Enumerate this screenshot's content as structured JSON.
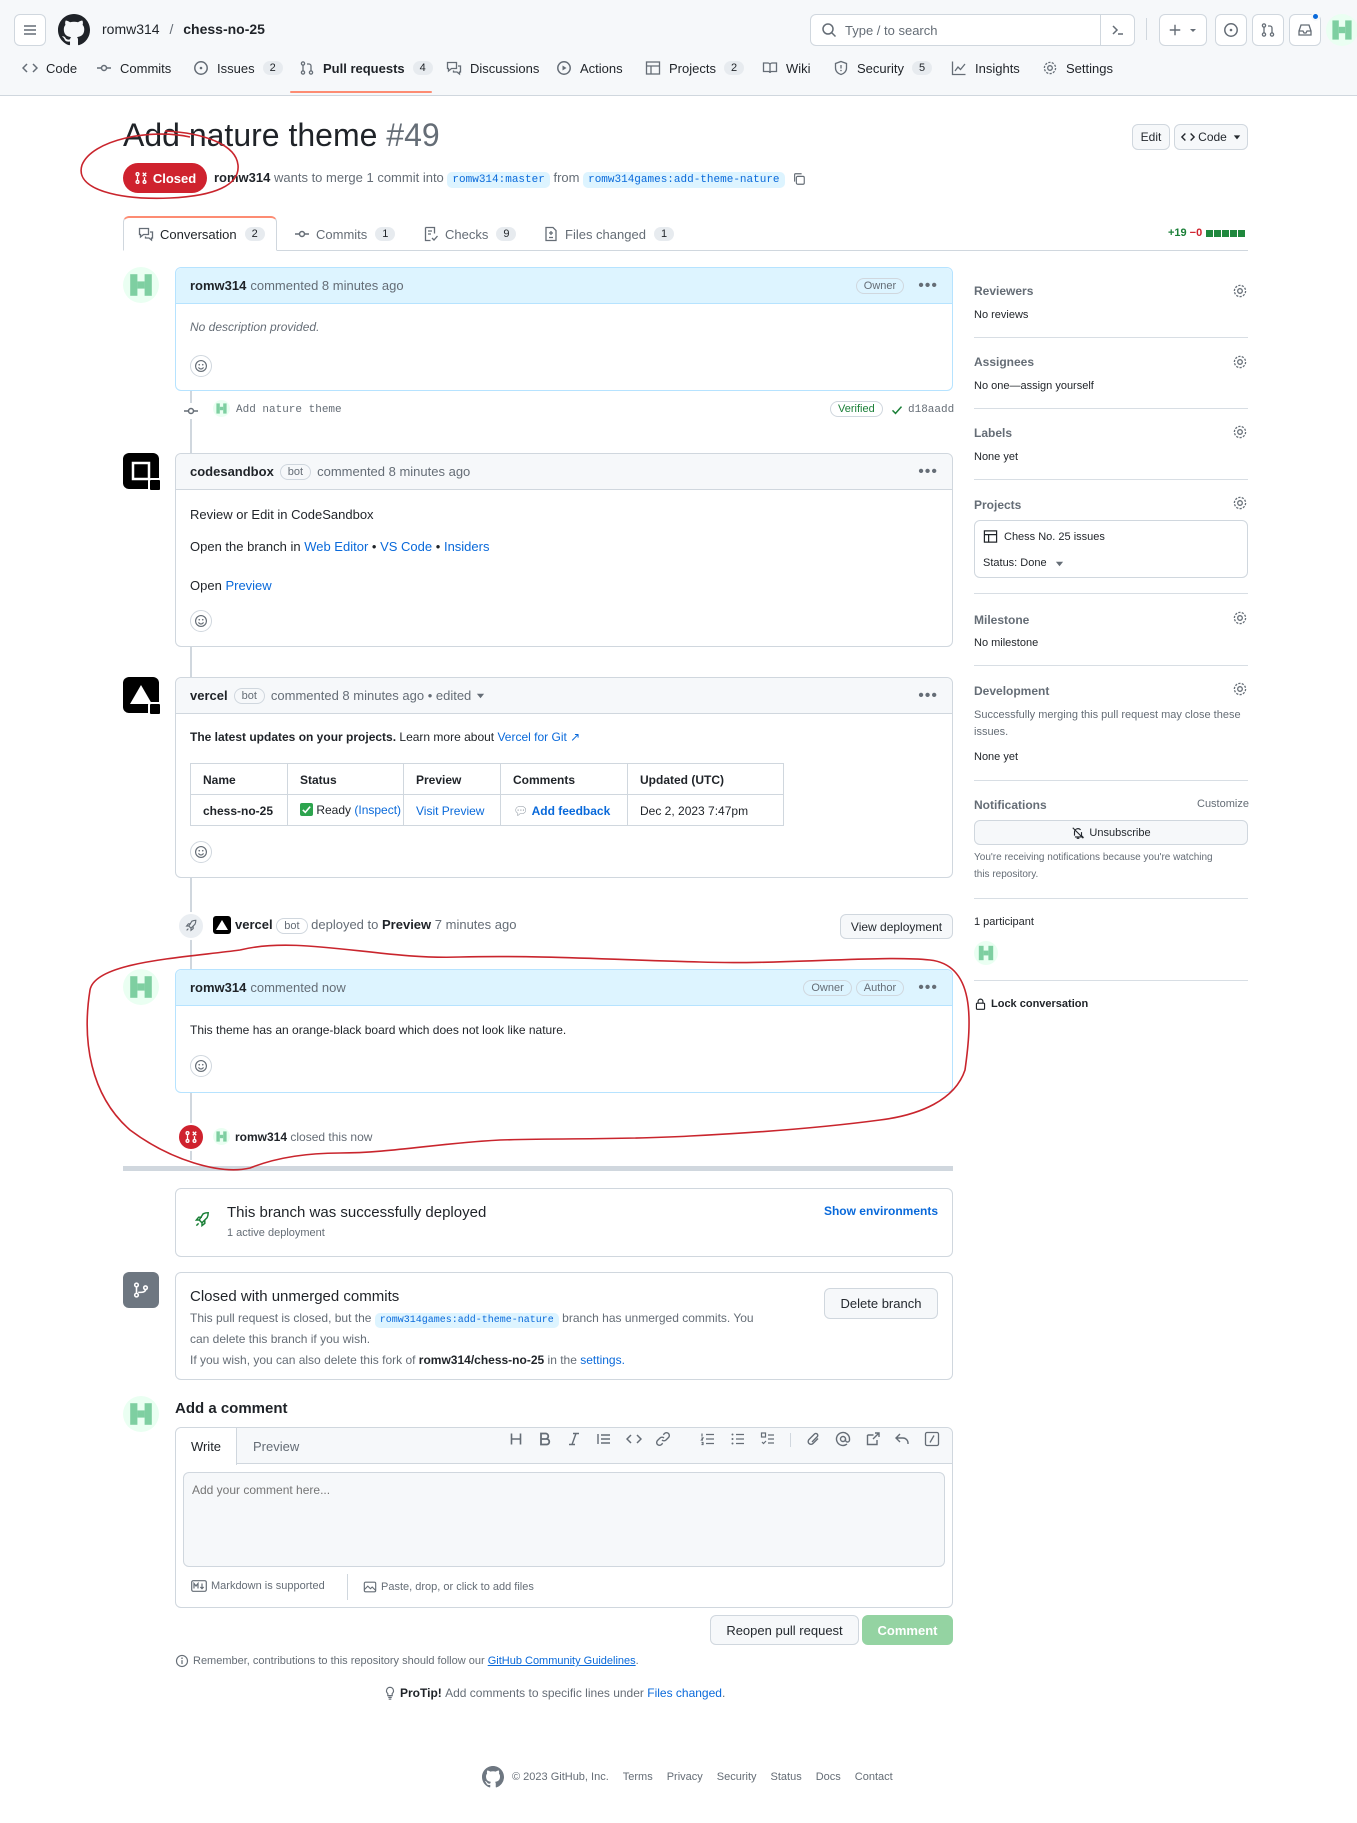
{
  "header": {
    "owner": "romw314",
    "repo": "chess-no-25",
    "search_placeholder": "Type / to search"
  },
  "repo_nav": [
    {
      "label": "Code"
    },
    {
      "label": "Commits"
    },
    {
      "label": "Issues",
      "count": "2"
    },
    {
      "label": "Pull requests",
      "count": "4"
    },
    {
      "label": "Discussions"
    },
    {
      "label": "Actions"
    },
    {
      "label": "Projects",
      "count": "2"
    },
    {
      "label": "Wiki"
    },
    {
      "label": "Security",
      "count": "5"
    },
    {
      "label": "Insights"
    },
    {
      "label": "Settings"
    }
  ],
  "pr": {
    "title": "Add nature theme",
    "number": "#49",
    "state": "Closed",
    "author": "romw314",
    "meta": "wants to merge 1 commit into",
    "base": "romw314:master",
    "from_word": "from",
    "head": "romw314games:add-theme-nature",
    "edit_label": "Edit",
    "code_label": "Code"
  },
  "tabs": [
    {
      "label": "Conversation",
      "count": "2"
    },
    {
      "label": "Commits",
      "count": "1"
    },
    {
      "label": "Checks",
      "count": "9"
    },
    {
      "label": "Files changed",
      "count": "1"
    }
  ],
  "diffstat": {
    "add": "+19",
    "del": "−0"
  },
  "timeline": {
    "c1": {
      "author": "romw314",
      "action": "commented 8 minutes ago",
      "badge": "Owner",
      "body": "No description provided."
    },
    "commit": {
      "message": "Add nature theme",
      "verified": "Verified",
      "sha": "d18aadd"
    },
    "c2": {
      "author": "codesandbox",
      "bot": "bot",
      "action": "commented 8 minutes ago",
      "title": "Review or Edit in CodeSandbox",
      "line1": "Open the branch in",
      "web_editor": "Web Editor",
      "sep": "•",
      "vs_code": "VS Code",
      "insiders": "Insiders",
      "open": "Open",
      "preview": "Preview"
    },
    "c3": {
      "author": "vercel",
      "bot": "bot",
      "action": "commented 8 minutes ago • edited",
      "intro": "The latest updates on your projects.",
      "learn": "Learn more about",
      "learn_link": "Vercel for Git ↗",
      "table_headers": [
        "Name",
        "Status",
        "Preview",
        "Comments",
        "Updated (UTC)"
      ],
      "row": {
        "name": "chess-no-25",
        "status": "Ready",
        "inspect": "(Inspect)",
        "preview": "Visit Preview",
        "comments": "Add feedback",
        "updated": "Dec 2, 2023 7:47pm"
      }
    },
    "deploy": {
      "actor": "vercel",
      "bot": "bot",
      "text": "deployed to",
      "env": "Preview",
      "time": "7 minutes ago",
      "button": "View deployment"
    },
    "c4": {
      "author": "romw314",
      "action": "commented now",
      "badge1": "Owner",
      "badge2": "Author",
      "body": "This theme has an orange-black board which does not look like nature."
    },
    "closed": {
      "actor": "romw314",
      "text": "closed this now"
    }
  },
  "deployed_box": {
    "title": "This branch was successfully deployed",
    "subtitle": "1 active deployment",
    "link": "Show environments"
  },
  "unmerged": {
    "title": "Closed with unmerged commits",
    "text1": "This pull request is closed, but the",
    "branch": "romw314games:add-theme-nature",
    "text2": "branch has unmerged commits. You",
    "text3": "can delete this branch if you wish.",
    "text4": "If you wish, you can also delete this fork of",
    "fork": "romw314/chess-no-25",
    "text5": "in the",
    "settings": "settings.",
    "button": "Delete branch"
  },
  "comment_form": {
    "heading": "Add a comment",
    "tab_write": "Write",
    "tab_preview": "Preview",
    "placeholder": "Add your comment here...",
    "markdown": "Markdown is supported",
    "attach": "Paste, drop, or click to add files",
    "reopen": "Reopen pull request",
    "comment": "Comment"
  },
  "remember": {
    "text": "Remember, contributions to this repository should follow our",
    "link": "GitHub Community Guidelines",
    "end": "."
  },
  "protip": {
    "label": "ProTip!",
    "text": "Add comments to specific lines under",
    "link": "Files changed",
    "end": "."
  },
  "sidebar": {
    "reviewers": {
      "h": "Reviewers",
      "v": "No reviews"
    },
    "assignees": {
      "h": "Assignees",
      "v": "No one—assign yourself"
    },
    "labels": {
      "h": "Labels",
      "v": "None yet"
    },
    "projects": {
      "h": "Projects",
      "name": "Chess No. 25 issues",
      "status": "Status: Done"
    },
    "milestone": {
      "h": "Milestone",
      "v": "No milestone"
    },
    "development": {
      "h": "Development",
      "v1": "Successfully merging this pull request may close these",
      "v2": "issues.",
      "v3": "None yet"
    },
    "notifications": {
      "h": "Notifications",
      "customize": "Customize",
      "button": "Unsubscribe",
      "note1": "You're receiving notifications because you're watching",
      "note2": "this repository."
    },
    "participants": "1 participant",
    "lock": "Lock conversation"
  },
  "footer": {
    "copyright": "© 2023 GitHub, Inc.",
    "links": [
      "Terms",
      "Privacy",
      "Security",
      "Status",
      "Docs",
      "Contact"
    ]
  },
  "colors": {
    "closed": "#cf222e",
    "link": "#0969da",
    "comment_green": "#94d3a2",
    "annotation": "#c9252d"
  }
}
